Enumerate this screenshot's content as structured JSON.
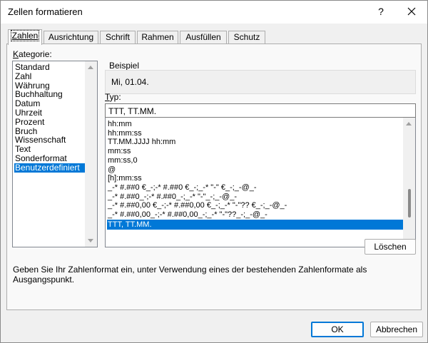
{
  "window": {
    "title": "Zellen formatieren",
    "help_label": "?",
    "close_icon": "close-icon"
  },
  "tabs": [
    {
      "label": "Zahlen",
      "active": true
    },
    {
      "label": "Ausrichtung",
      "active": false
    },
    {
      "label": "Schrift",
      "active": false
    },
    {
      "label": "Rahmen",
      "active": false
    },
    {
      "label": "Ausfüllen",
      "active": false
    },
    {
      "label": "Schutz",
      "active": false
    }
  ],
  "category": {
    "label": "Kategorie:",
    "items": [
      "Standard",
      "Zahl",
      "Währung",
      "Buchhaltung",
      "Datum",
      "Uhrzeit",
      "Prozent",
      "Bruch",
      "Wissenschaft",
      "Text",
      "Sonderformat",
      "Benutzerdefiniert"
    ],
    "selected": "Benutzerdefiniert"
  },
  "sample": {
    "label": "Beispiel",
    "value": "Mi, 01.04."
  },
  "type": {
    "label": "Typ:",
    "value": "TTT, TT.MM.",
    "formats": [
      "hh:mm",
      "hh:mm:ss",
      "TT.MM.JJJJ hh:mm",
      "mm:ss",
      "mm:ss,0",
      "@",
      "[h]:mm:ss",
      "_-* #.##0 €_-;-* #.##0 €_-;_-* \"-\" €_-;_-@_-",
      "_-* #.##0_-;-* #.##0_-;_-* \"-\"_-;_-@_-",
      "_-* #.##0,00 €_-;-* #.##0,00 €_-;_-* \"-\"?? €_-;_-@_-",
      "_-* #.##0,00_-;-* #.##0,00_-;_-* \"-\"??_-;_-@_-",
      "TTT, TT.MM."
    ],
    "selected": "TTT, TT.MM."
  },
  "buttons": {
    "delete": "Löschen",
    "ok": "OK",
    "cancel": "Abbrechen"
  },
  "hint": "Geben Sie Ihr Zahlenformat ein, unter Verwendung eines der bestehenden Zahlenformate als Ausgangspunkt."
}
